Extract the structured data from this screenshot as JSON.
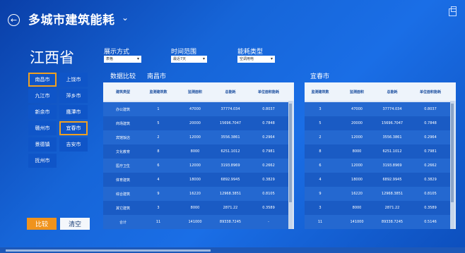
{
  "header": {
    "title": "多城市建筑能耗",
    "chevron": "⌄",
    "back_glyph": "←"
  },
  "province": "江西省",
  "filters": [
    {
      "label": "展示方式",
      "value": "表格"
    },
    {
      "label": "时间范围",
      "value": "最近7天"
    },
    {
      "label": "能耗类型",
      "value": "空调用电"
    }
  ],
  "cities": [
    {
      "name": "南昌市",
      "selected": true
    },
    {
      "name": "上饶市",
      "selected": false
    },
    {
      "name": "九江市",
      "selected": false
    },
    {
      "name": "萍乡市",
      "selected": false
    },
    {
      "name": "新余市",
      "selected": false
    },
    {
      "name": "鹰潭市",
      "selected": false
    },
    {
      "name": "赣州市",
      "selected": false
    },
    {
      "name": "宜春市",
      "selected": true
    },
    {
      "name": "景德镇",
      "selected": false
    },
    {
      "name": "吉安市",
      "selected": false
    },
    {
      "name": "抚州市",
      "selected": false
    }
  ],
  "buttons": {
    "compare": "比较",
    "clear": "清空"
  },
  "data_compare_label": "数据比较",
  "row_header": "建筑类型",
  "columns": [
    "监测建筑数",
    "监测面积",
    "总能耗",
    "单位面积能耗"
  ],
  "building_types": [
    "办公建筑",
    "商场建筑",
    "宾馆饭店",
    "文化教育",
    "医疗卫生",
    "体育建筑",
    "综合建筑",
    "其它建筑",
    "合计"
  ],
  "tables": [
    {
      "city": "南昌市",
      "rows": [
        [
          "1",
          "47000",
          "37774.034",
          "0.8037"
        ],
        [
          "5",
          "20000",
          "15696.7047",
          "0.7848"
        ],
        [
          "2",
          "12000",
          "3556.3861",
          "0.2964"
        ],
        [
          "8",
          "8000",
          "6251.1012",
          "0.7981"
        ],
        [
          "6",
          "12000",
          "3193.8969",
          "0.2662"
        ],
        [
          "4",
          "18000",
          "6892.9945",
          "0.3829"
        ],
        [
          "9",
          "16220",
          "12968.3851",
          "0.8105"
        ],
        [
          "3",
          "8000",
          "2871.22",
          "0.3589"
        ],
        [
          "11",
          "141000",
          "89338.7245",
          "-"
        ]
      ]
    },
    {
      "city": "宜春市",
      "rows": [
        [
          "3",
          "47000",
          "37774.034",
          "0.8037"
        ],
        [
          "5",
          "20000",
          "15696.7047",
          "0.7848"
        ],
        [
          "2",
          "12000",
          "3556.3861",
          "0.2964"
        ],
        [
          "8",
          "8000",
          "6251.1012",
          "0.7981"
        ],
        [
          "6",
          "12000",
          "3193.8969",
          "0.2662"
        ],
        [
          "4",
          "18000",
          "6892.9945",
          "0.3829"
        ],
        [
          "9",
          "16220",
          "12968.3851",
          "0.8105"
        ],
        [
          "3",
          "8000",
          "2871.22",
          "0.3589"
        ],
        [
          "11",
          "141000",
          "89338.7245",
          "0.5146"
        ]
      ]
    }
  ]
}
